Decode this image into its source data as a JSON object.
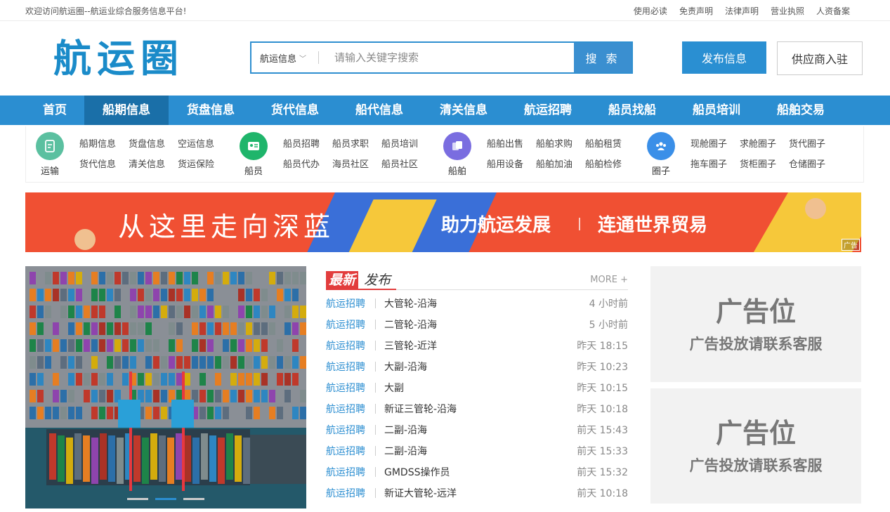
{
  "topbar": {
    "welcome": "欢迎访问航运圈--航运业综合服务信息平台!",
    "links": [
      "使用必读",
      "免责声明",
      "法律声明",
      "营业执照",
      "人资备案"
    ]
  },
  "header": {
    "logo": "航运圈",
    "search_category": "航运信息",
    "search_placeholder": "请输入关键字搜索",
    "search_button": "搜 索",
    "publish_button": "发布信息",
    "supplier_button": "供应商入驻"
  },
  "nav": {
    "items": [
      "首页",
      "船期信息",
      "货盘信息",
      "货代信息",
      "船代信息",
      "清关信息",
      "航运招聘",
      "船员找船",
      "船员培训",
      "船舶交易"
    ],
    "active_index": 1
  },
  "subnav": {
    "groups": [
      {
        "name": "运输",
        "icon": "document-icon",
        "color": "#5bc0a0",
        "links": [
          "船期信息",
          "货盘信息",
          "空运信息",
          "货代信息",
          "清关信息",
          "货运保险"
        ]
      },
      {
        "name": "船员",
        "icon": "id-card-icon",
        "color": "#1fb56b",
        "links": [
          "船员招聘",
          "船员求职",
          "船员培训",
          "船员代办",
          "海员社区",
          "船员社区"
        ]
      },
      {
        "name": "船舶",
        "icon": "copy-icon",
        "color": "#7a6de0",
        "links": [
          "船舶出售",
          "船舶求购",
          "船舶租赁",
          "船用设备",
          "船舶加油",
          "船舶检修"
        ]
      },
      {
        "name": "圈子",
        "icon": "group-icon",
        "color": "#3a8fe8",
        "links": [
          "现舱圈子",
          "求舱圈子",
          "货代圈子",
          "拖车圈子",
          "货柜圈子",
          "仓储圈子"
        ]
      }
    ]
  },
  "banner": {
    "slogan_left": "从这里走向深蓝",
    "slogan_mid": "助力航运发展",
    "slogan_right": "连通世界贸易",
    "ad_tag": "广告"
  },
  "latest": {
    "tag_red": "最新",
    "tag_text": "发布",
    "more": "MORE +",
    "items": [
      {
        "cat": "航运招聘",
        "title": "大管轮-沿海",
        "time": "4 小时前"
      },
      {
        "cat": "航运招聘",
        "title": "二管轮-沿海",
        "time": "5 小时前"
      },
      {
        "cat": "航运招聘",
        "title": "三管轮-近洋",
        "time": "昨天 18:15"
      },
      {
        "cat": "航运招聘",
        "title": "大副-沿海",
        "time": "昨天 10:23"
      },
      {
        "cat": "航运招聘",
        "title": "大副",
        "time": "昨天 10:15"
      },
      {
        "cat": "航运招聘",
        "title": "新证三管轮-沿海",
        "time": "昨天 10:18"
      },
      {
        "cat": "航运招聘",
        "title": "二副-沿海",
        "time": "前天 15:43"
      },
      {
        "cat": "航运招聘",
        "title": "二副-沿海",
        "time": "前天 15:33"
      },
      {
        "cat": "航运招聘",
        "title": "GMDSS操作员",
        "time": "前天 15:32"
      },
      {
        "cat": "航运招聘",
        "title": "新证大管轮-远洋",
        "time": "前天 10:18"
      }
    ]
  },
  "ads": [
    {
      "big": "广告位",
      "small": "广告投放请联系客服"
    },
    {
      "big": "广告位",
      "small": "广告投放请联系客服"
    }
  ],
  "carousel": {
    "slides": 3,
    "active": 2
  }
}
